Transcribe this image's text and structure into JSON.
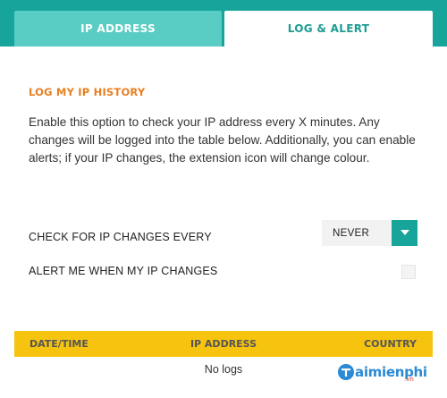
{
  "tabs": {
    "ip_address": "IP ADDRESS",
    "log_alert": "LOG & ALERT"
  },
  "section": {
    "title": "LOG MY IP HISTORY",
    "description": "Enable this option to check your IP address every X minutes. Any changes will be logged into the table below. Additionally, you can enable alerts; if your IP changes, the extension icon will change colour."
  },
  "settings": {
    "check_label": "CHECK FOR IP CHANGES EVERY",
    "check_value": "NEVER",
    "alert_label": "ALERT ME WHEN MY IP CHANGES",
    "alert_checked": false
  },
  "table": {
    "columns": [
      "DATE/TIME",
      "IP ADDRESS",
      "COUNTRY"
    ],
    "empty_text": "No logs"
  },
  "watermark": {
    "brand": "aimienphi",
    "brand_sub": ".vn"
  },
  "colors": {
    "teal": "#17a49b",
    "teal_light": "#59ccc3",
    "orange": "#e67f22",
    "yellow": "#f6c40f"
  },
  "icons": {
    "select_arrow": "chevron-down-icon",
    "watermark_logo": "taimienphi-logo-icon"
  }
}
